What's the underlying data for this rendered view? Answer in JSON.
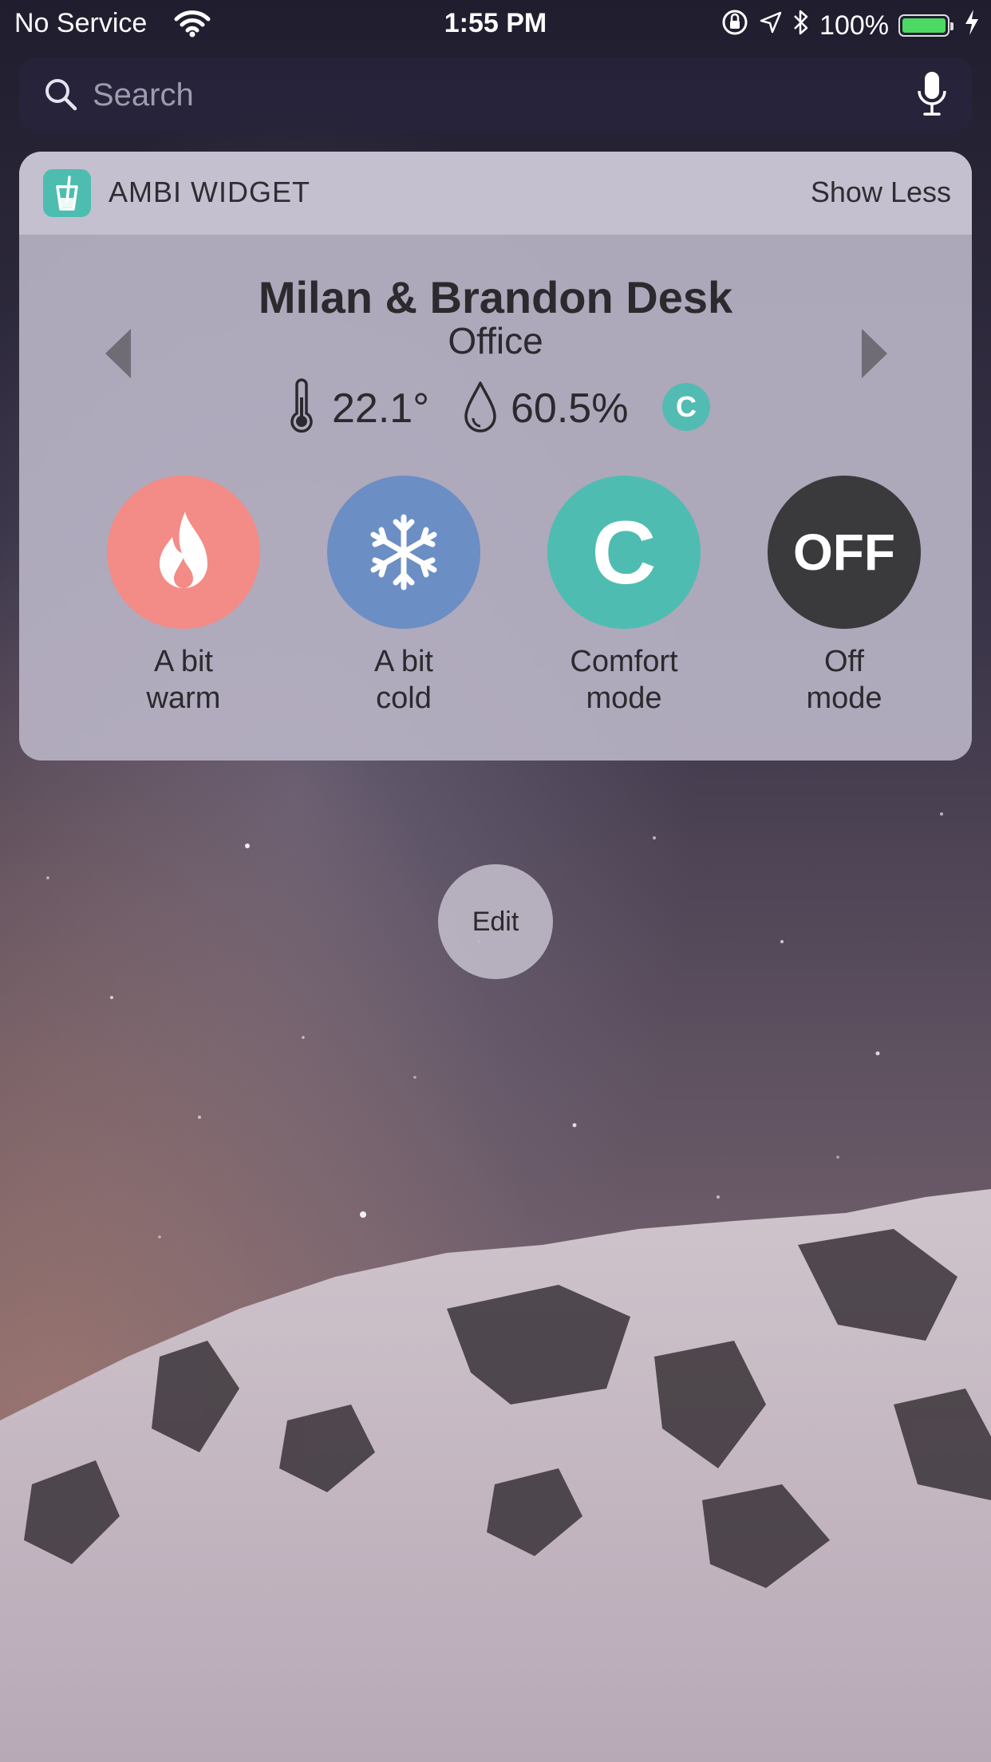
{
  "status_bar": {
    "carrier": "No Service",
    "time": "1:55 PM",
    "battery_percent": "100%",
    "icons": [
      "wifi-icon",
      "orientation-lock-icon",
      "location-icon",
      "bluetooth-icon",
      "battery-icon",
      "charging-icon"
    ]
  },
  "search": {
    "placeholder": "Search",
    "icon": "search-icon",
    "mic_icon": "mic-icon"
  },
  "widget": {
    "app_name": "AMBI WIDGET",
    "show_less_label": "Show Less",
    "device": {
      "name": "Milan & Brandon Desk",
      "room": "Office",
      "temperature": "22.1°",
      "humidity": "60.5%",
      "current_mode_badge": "C"
    },
    "modes": [
      {
        "label_line1": "A bit",
        "label_line2": "warm",
        "icon": "flame-icon",
        "color": "#f38b86"
      },
      {
        "label_line1": "A bit",
        "label_line2": "cold",
        "icon": "snowflake-icon",
        "color": "#6b8ec4"
      },
      {
        "label_line1": "Comfort",
        "label_line2": "mode",
        "glyph": "C",
        "color": "#4fbcb1"
      },
      {
        "label_line1": "Off",
        "label_line2": "mode",
        "glyph": "OFF",
        "color": "#3a3a3c"
      }
    ]
  },
  "edit_label": "Edit"
}
